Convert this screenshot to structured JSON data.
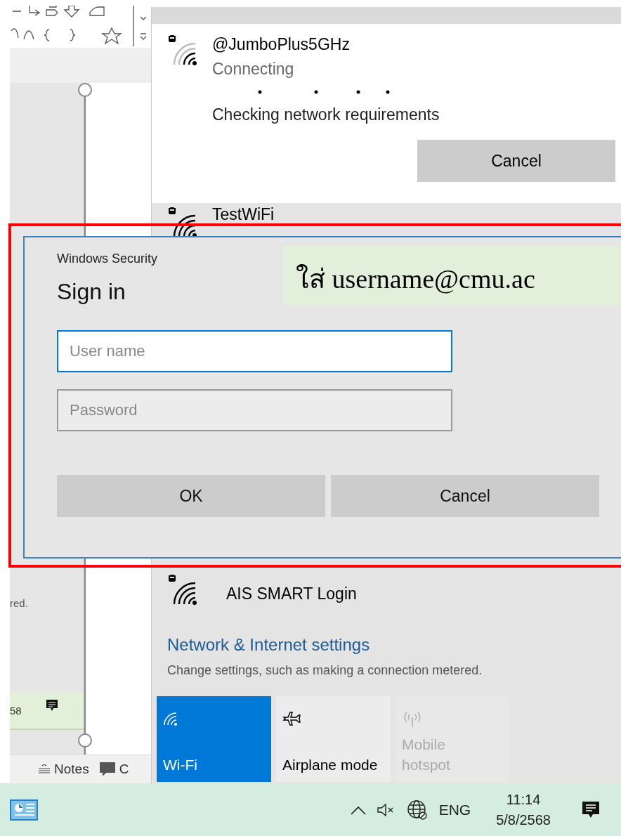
{
  "background_app": {
    "cut_text": "red.",
    "thumbnail_text": "58",
    "notes_label": "Notes",
    "comments_label": "C"
  },
  "network_flyout": {
    "networks": [
      {
        "name": "@JumboPlus5GHz",
        "status": "Connecting",
        "progress_text": "Checking network requirements",
        "button": "Cancel",
        "expanded": true
      },
      {
        "name": "TestWiFi",
        "expanded": false
      },
      {
        "name": "AIS SMART Login",
        "expanded": false
      }
    ],
    "settings_link": "Network & Internet settings",
    "settings_hint": "Change settings, such as making a connection metered.",
    "quick_actions": [
      {
        "kind": "wifi",
        "label": "Wi-Fi",
        "on": true,
        "disabled": false
      },
      {
        "kind": "airplane",
        "label": "Airplane mode",
        "on": false,
        "disabled": false
      },
      {
        "kind": "hotspot",
        "label": "Mobile hotspot",
        "on": false,
        "disabled": true
      }
    ]
  },
  "sign_in_dialog": {
    "app_title": "Windows Security",
    "title": "Sign in",
    "fields": [
      {
        "placeholder": "User name",
        "focused": true
      },
      {
        "placeholder": "Password",
        "focused": false
      }
    ],
    "buttons": [
      "OK",
      "Cancel"
    ]
  },
  "annotation": {
    "text": "ใส่ username@cmu.ac"
  },
  "taskbar": {
    "language": "ENG",
    "time": "11:14",
    "date": "5/8/2568"
  }
}
